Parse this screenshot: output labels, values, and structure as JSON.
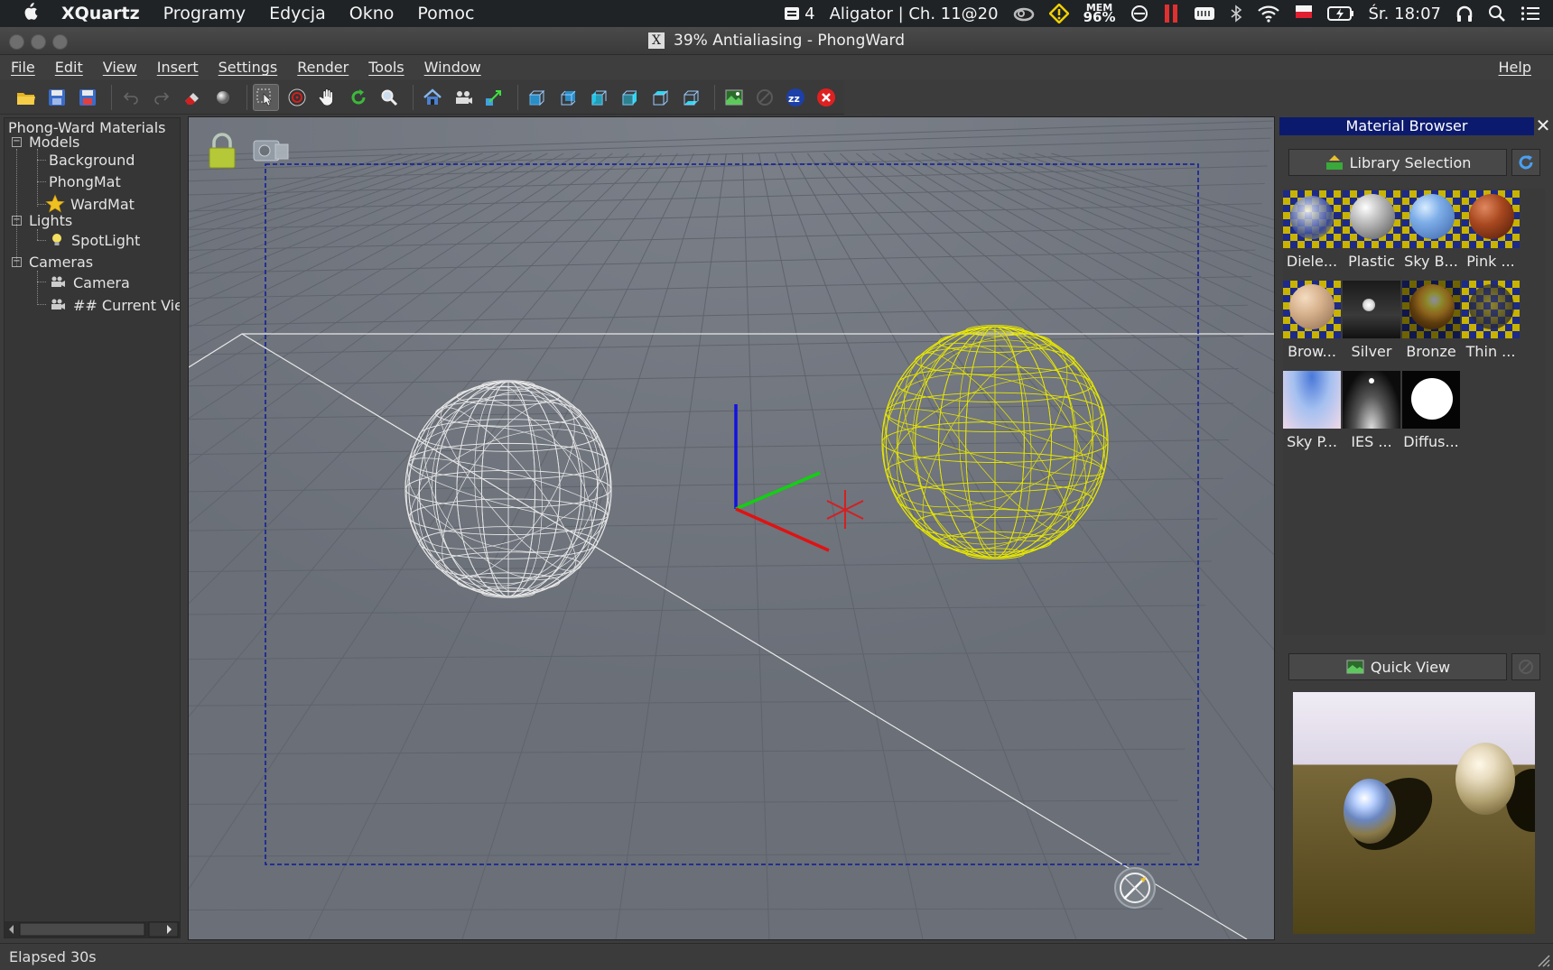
{
  "mac_menubar": {
    "app_name": "XQuartz",
    "menus": [
      "Programy",
      "Edycja",
      "Okno",
      "Pomoc"
    ],
    "status": {
      "desktop_number": "4",
      "event": "Aligator | Ch. 11@20",
      "mem_label": "MEM",
      "mem_value": "96%",
      "clock": "Śr. 18:07"
    }
  },
  "window": {
    "title": "39% Antialiasing - PhongWard"
  },
  "app_menu": {
    "items": [
      "File",
      "Edit",
      "View",
      "Insert",
      "Settings",
      "Render",
      "Tools",
      "Window"
    ],
    "help": "Help"
  },
  "toolbar": {
    "icons": [
      "open-folder-icon",
      "save-icon",
      "save-as-icon",
      "undo-icon",
      "redo-icon",
      "eraser-icon",
      "sphere-icon",
      "select-arrow-icon",
      "target-icon",
      "hand-pan-icon",
      "rotate-icon",
      "zoom-icon",
      "home-icon",
      "camera-icon",
      "scale-icon",
      "cube-front-icon",
      "cube-back-icon",
      "cube-left-icon",
      "cube-right-icon",
      "cube-top-icon",
      "cube-bottom-icon",
      "render-image-icon",
      "render-stop-icon",
      "zzz-icon",
      "close-red-icon"
    ]
  },
  "scene_tree": {
    "root": "Phong-Ward Materials",
    "models_label": "Models",
    "models": [
      "Background",
      "PhongMat",
      "WardMat"
    ],
    "lights_label": "Lights",
    "lights": [
      "SpotLight"
    ],
    "cameras_label": "Cameras",
    "cameras": [
      "Camera",
      "## Current View"
    ],
    "expander_symbol": "−"
  },
  "material_browser": {
    "title": "Material Browser",
    "library_button": "Library Selection",
    "quick_view_button": "Quick View",
    "materials": [
      {
        "label": "Diele..."
      },
      {
        "label": "Plastic"
      },
      {
        "label": "Sky B..."
      },
      {
        "label": "Pink ..."
      },
      {
        "label": "Brow..."
      },
      {
        "label": "Silver"
      },
      {
        "label": "Bronze"
      },
      {
        "label": "Thin ..."
      },
      {
        "label": "Sky P..."
      },
      {
        "label": "IES ..."
      },
      {
        "label": "Diffus..."
      }
    ]
  },
  "status_bar": {
    "text": "Elapsed 30s"
  },
  "colors": {
    "viewport_bg": "#707680",
    "selected_sphere": "#e6e600",
    "unselected_sphere": "#e6e6e6",
    "axis_x": "#e01010",
    "axis_y": "#10d010",
    "axis_z": "#1010e0",
    "panel_header": "#0c1a6e"
  }
}
